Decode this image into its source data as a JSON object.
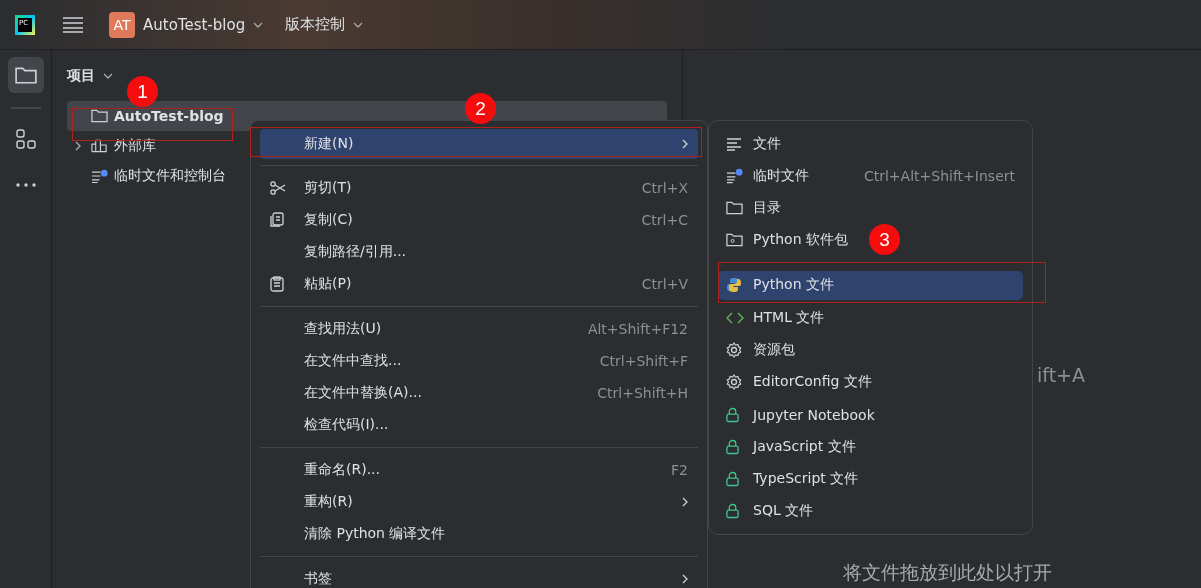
{
  "toolbar": {
    "logo_text": "PC",
    "project_badge": "AT",
    "project": "AutoTest-blog",
    "vcs": "版本控制"
  },
  "panel": {
    "title": "项目",
    "tree": [
      {
        "label": "AutoTest-blog",
        "kind": "folder",
        "selected": true
      },
      {
        "label": "外部库",
        "kind": "library",
        "expanded": false,
        "selected": false
      },
      {
        "label": "临时文件和控制台",
        "kind": "scratch",
        "selected": false
      }
    ]
  },
  "editor": {
    "hint_fragment": "ift+A",
    "drop_hint": "将文件拖放到此处以打开"
  },
  "context_menu": {
    "items": [
      {
        "kind": "plain",
        "label": "新建(N)",
        "submenu": true,
        "selected": true
      },
      {
        "kind": "separator"
      },
      {
        "kind": "cut",
        "label": "剪切(T)",
        "shortcut": "Ctrl+X",
        "selected": false
      },
      {
        "kind": "copy",
        "label": "复制(C)",
        "shortcut": "Ctrl+C",
        "selected": false
      },
      {
        "kind": "plain",
        "label": "复制路径/引用...",
        "selected": false
      },
      {
        "kind": "paste",
        "label": "粘贴(P)",
        "shortcut": "Ctrl+V",
        "selected": false
      },
      {
        "kind": "separator"
      },
      {
        "kind": "plain",
        "label": "查找用法(U)",
        "shortcut": "Alt+Shift+F12",
        "selected": false
      },
      {
        "kind": "plain",
        "label": "在文件中查找...",
        "shortcut": "Ctrl+Shift+F",
        "selected": false
      },
      {
        "kind": "plain",
        "label": "在文件中替换(A)...",
        "shortcut": "Ctrl+Shift+H",
        "selected": false
      },
      {
        "kind": "plain",
        "label": "检查代码(I)...",
        "selected": false
      },
      {
        "kind": "separator"
      },
      {
        "kind": "plain",
        "label": "重命名(R)...",
        "shortcut": "F2",
        "selected": false
      },
      {
        "kind": "plain",
        "label": "重构(R)",
        "submenu": true,
        "selected": false
      },
      {
        "kind": "plain",
        "label": "清除 Python 编译文件",
        "selected": false
      },
      {
        "kind": "separator"
      },
      {
        "kind": "plain",
        "label": "书签",
        "submenu": true,
        "selected": false
      }
    ]
  },
  "submenu": {
    "items": [
      {
        "kind": "text-file",
        "label": "文件",
        "selected": false
      },
      {
        "kind": "scratch",
        "label": "临时文件",
        "shortcut": "Ctrl+Alt+Shift+Insert",
        "selected": false
      },
      {
        "kind": "folder",
        "label": "目录",
        "selected": false
      },
      {
        "kind": "package",
        "label": "Python 软件包",
        "selected": false
      },
      {
        "kind": "separator"
      },
      {
        "kind": "python",
        "label": "Python 文件",
        "selected": true
      },
      {
        "kind": "html",
        "label": "HTML 文件",
        "selected": false
      },
      {
        "kind": "gear",
        "label": "资源包",
        "selected": false
      },
      {
        "kind": "gear",
        "label": "EditorConfig 文件",
        "selected": false
      },
      {
        "kind": "lock",
        "label": "Jupyter Notebook",
        "selected": false
      },
      {
        "kind": "lock",
        "label": "JavaScript 文件",
        "selected": false
      },
      {
        "kind": "lock",
        "label": "TypeScript 文件",
        "selected": false
      },
      {
        "kind": "lock",
        "label": "SQL 文件",
        "selected": false
      }
    ]
  },
  "annotations": [
    {
      "number": "1"
    },
    {
      "number": "2"
    },
    {
      "number": "3"
    }
  ]
}
